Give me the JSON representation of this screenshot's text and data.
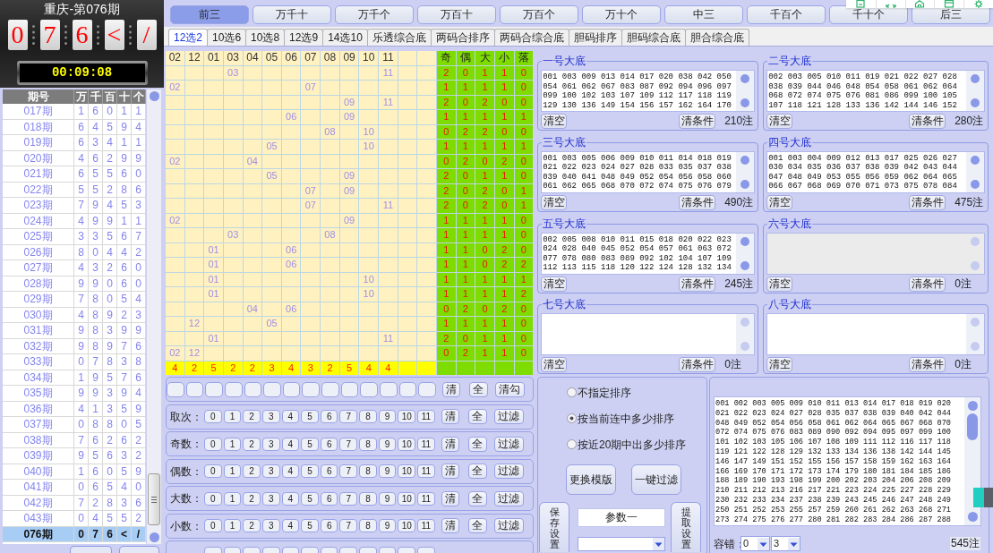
{
  "draw": {
    "title": "重庆-第076期",
    "digits": [
      "0",
      "7",
      "6",
      "<",
      "/"
    ],
    "timer": "00:09:08"
  },
  "history": {
    "columns": [
      "期号",
      "万",
      "千",
      "百",
      "十",
      "个"
    ],
    "rows": [
      {
        "period": "017期",
        "digits": [
          "1",
          "6",
          "0",
          "1",
          "1"
        ],
        "selected": false
      },
      {
        "period": "018期",
        "digits": [
          "6",
          "4",
          "5",
          "9",
          "4"
        ],
        "selected": false
      },
      {
        "period": "019期",
        "digits": [
          "6",
          "3",
          "4",
          "1",
          "1"
        ],
        "selected": false
      },
      {
        "period": "020期",
        "digits": [
          "4",
          "6",
          "2",
          "9",
          "9"
        ],
        "selected": false
      },
      {
        "period": "021期",
        "digits": [
          "6",
          "5",
          "5",
          "6",
          "0"
        ],
        "selected": false
      },
      {
        "period": "022期",
        "digits": [
          "5",
          "5",
          "2",
          "8",
          "6"
        ],
        "selected": false
      },
      {
        "period": "023期",
        "digits": [
          "7",
          "9",
          "4",
          "5",
          "3"
        ],
        "selected": false
      },
      {
        "period": "024期",
        "digits": [
          "4",
          "9",
          "9",
          "1",
          "1"
        ],
        "selected": false
      },
      {
        "period": "025期",
        "digits": [
          "3",
          "3",
          "5",
          "6",
          "7"
        ],
        "selected": false
      },
      {
        "period": "026期",
        "digits": [
          "8",
          "0",
          "4",
          "4",
          "2"
        ],
        "selected": false
      },
      {
        "period": "027期",
        "digits": [
          "4",
          "3",
          "2",
          "6",
          "0"
        ],
        "selected": false
      },
      {
        "period": "028期",
        "digits": [
          "9",
          "9",
          "0",
          "6",
          "0"
        ],
        "selected": false
      },
      {
        "period": "029期",
        "digits": [
          "7",
          "8",
          "0",
          "5",
          "4"
        ],
        "selected": false
      },
      {
        "period": "030期",
        "digits": [
          "4",
          "8",
          "9",
          "2",
          "3"
        ],
        "selected": false
      },
      {
        "period": "031期",
        "digits": [
          "9",
          "8",
          "3",
          "9",
          "9"
        ],
        "selected": false
      },
      {
        "period": "032期",
        "digits": [
          "9",
          "8",
          "9",
          "7",
          "6"
        ],
        "selected": false
      },
      {
        "period": "033期",
        "digits": [
          "0",
          "7",
          "8",
          "3",
          "8"
        ],
        "selected": false
      },
      {
        "period": "034期",
        "digits": [
          "1",
          "9",
          "5",
          "7",
          "6"
        ],
        "selected": false
      },
      {
        "period": "035期",
        "digits": [
          "9",
          "9",
          "3",
          "9",
          "4"
        ],
        "selected": false
      },
      {
        "period": "036期",
        "digits": [
          "4",
          "1",
          "3",
          "5",
          "9"
        ],
        "selected": false
      },
      {
        "period": "037期",
        "digits": [
          "0",
          "8",
          "8",
          "0",
          "5"
        ],
        "selected": false
      },
      {
        "period": "038期",
        "digits": [
          "7",
          "6",
          "2",
          "6",
          "2"
        ],
        "selected": false
      },
      {
        "period": "039期",
        "digits": [
          "9",
          "5",
          "6",
          "3",
          "2"
        ],
        "selected": false
      },
      {
        "period": "040期",
        "digits": [
          "1",
          "6",
          "0",
          "5",
          "9"
        ],
        "selected": false
      },
      {
        "period": "041期",
        "digits": [
          "0",
          "6",
          "5",
          "4",
          "0"
        ],
        "selected": false
      },
      {
        "period": "042期",
        "digits": [
          "7",
          "2",
          "8",
          "3",
          "6"
        ],
        "selected": false
      },
      {
        "period": "043期",
        "digits": [
          "0",
          "4",
          "5",
          "5",
          "2"
        ],
        "selected": false
      },
      {
        "period": "076期",
        "digits": [
          "0",
          "7",
          "6",
          "<",
          "/"
        ],
        "selected": true
      }
    ]
  },
  "position_tabs": [
    {
      "label": "前三",
      "selected": true
    },
    {
      "label": "万千十",
      "selected": false
    },
    {
      "label": "万千个",
      "selected": false
    },
    {
      "label": "万百十",
      "selected": false
    },
    {
      "label": "万百个",
      "selected": false
    },
    {
      "label": "万十个",
      "selected": false
    },
    {
      "label": "中三",
      "selected": false
    },
    {
      "label": "千百个",
      "selected": false
    },
    {
      "label": "千十个",
      "selected": false
    },
    {
      "label": "后三",
      "selected": false
    }
  ],
  "mode_tabs": [
    {
      "label": "12选2",
      "selected": true
    },
    {
      "label": "10选6",
      "selected": false
    },
    {
      "label": "10选8",
      "selected": false
    },
    {
      "label": "12选9",
      "selected": false
    },
    {
      "label": "14选10",
      "selected": false
    },
    {
      "label": "乐透综合底",
      "selected": false
    },
    {
      "label": "两码合排序",
      "selected": false
    },
    {
      "label": "两码合综合底",
      "selected": false
    },
    {
      "label": "胆码排序",
      "selected": false
    },
    {
      "label": "胆码综合底",
      "selected": false
    },
    {
      "label": "胆合综合底",
      "selected": false
    }
  ],
  "grid": {
    "header": [
      "02",
      "12",
      "01",
      "03",
      "04",
      "05",
      "06",
      "07",
      "08",
      "09",
      "10",
      "11"
    ],
    "stat_header": [
      "奇",
      "偶",
      "大",
      "小",
      "落"
    ],
    "rows": [
      {
        "cells": [
          {},
          {},
          {},
          {
            "value": "03"
          },
          {},
          {},
          {},
          {},
          {},
          {},
          {},
          {
            "value": "11"
          },
          {},
          {}
        ],
        "stats": [
          "2",
          "0",
          "1",
          "1",
          "0"
        ]
      },
      {
        "cells": [
          {
            "value": "02"
          },
          {},
          {},
          {},
          {},
          {},
          {},
          {
            "value": "07"
          },
          {},
          {},
          {},
          {},
          {},
          {}
        ],
        "stats": [
          "1",
          "1",
          "1",
          "1",
          "0"
        ]
      },
      {
        "cells": [
          {},
          {},
          {},
          {},
          {},
          {},
          {},
          {},
          {},
          {
            "value": "09"
          },
          {},
          {
            "value": "11"
          },
          {},
          {}
        ],
        "stats": [
          "2",
          "0",
          "2",
          "0",
          "0"
        ]
      },
      {
        "cells": [
          {},
          {},
          {},
          {},
          {},
          {},
          {
            "value": "06"
          },
          {},
          {},
          {
            "value": "09"
          },
          {},
          {},
          {},
          {}
        ],
        "stats": [
          "1",
          "1",
          "1",
          "1",
          "1"
        ]
      },
      {
        "cells": [
          {},
          {},
          {},
          {},
          {},
          {},
          {},
          {},
          {
            "value": "08"
          },
          {},
          {
            "value": "10"
          },
          {},
          {},
          {}
        ],
        "stats": [
          "0",
          "2",
          "2",
          "0",
          "0"
        ]
      },
      {
        "cells": [
          {},
          {},
          {},
          {},
          {},
          {
            "value": "05"
          },
          {},
          {},
          {},
          {},
          {
            "value": "10"
          },
          {},
          {},
          {}
        ],
        "stats": [
          "1",
          "1",
          "1",
          "1",
          "1"
        ]
      },
      {
        "cells": [
          {
            "value": "02"
          },
          {},
          {},
          {},
          {
            "value": "04"
          },
          {},
          {},
          {},
          {},
          {},
          {},
          {},
          {},
          {}
        ],
        "stats": [
          "0",
          "2",
          "0",
          "2",
          "0"
        ]
      },
      {
        "cells": [
          {},
          {},
          {},
          {},
          {},
          {
            "value": "05"
          },
          {},
          {},
          {},
          {
            "value": "09"
          },
          {},
          {},
          {},
          {}
        ],
        "stats": [
          "2",
          "0",
          "1",
          "1",
          "0"
        ]
      },
      {
        "cells": [
          {},
          {},
          {},
          {},
          {},
          {},
          {},
          {
            "value": "07"
          },
          {},
          {
            "value": "09"
          },
          {},
          {},
          {},
          {}
        ],
        "stats": [
          "2",
          "0",
          "2",
          "0",
          "1"
        ]
      },
      {
        "cells": [
          {},
          {},
          {},
          {},
          {},
          {},
          {},
          {
            "value": "07"
          },
          {},
          {},
          {},
          {
            "value": "11"
          },
          {},
          {}
        ],
        "stats": [
          "2",
          "0",
          "2",
          "0",
          "1"
        ]
      },
      {
        "cells": [
          {
            "value": "02"
          },
          {},
          {},
          {},
          {},
          {},
          {},
          {},
          {},
          {
            "value": "09"
          },
          {},
          {},
          {},
          {}
        ],
        "stats": [
          "1",
          "1",
          "1",
          "1",
          "0"
        ]
      },
      {
        "cells": [
          {},
          {},
          {},
          {
            "value": "03"
          },
          {},
          {},
          {},
          {},
          {
            "value": "08"
          },
          {},
          {},
          {},
          {},
          {}
        ],
        "stats": [
          "1",
          "1",
          "1",
          "1",
          "0"
        ]
      },
      {
        "cells": [
          {},
          {},
          {
            "value": "01"
          },
          {},
          {},
          {},
          {
            "value": "06"
          },
          {},
          {},
          {},
          {},
          {},
          {},
          {}
        ],
        "stats": [
          "1",
          "1",
          "0",
          "2",
          "0"
        ]
      },
      {
        "cells": [
          {},
          {},
          {
            "value": "01"
          },
          {},
          {},
          {},
          {
            "value": "06"
          },
          {},
          {},
          {},
          {},
          {},
          {},
          {}
        ],
        "stats": [
          "1",
          "1",
          "0",
          "2",
          "2"
        ]
      },
      {
        "cells": [
          {},
          {},
          {
            "value": "01"
          },
          {},
          {},
          {},
          {},
          {},
          {},
          {},
          {
            "value": "10"
          },
          {},
          {},
          {}
        ],
        "stats": [
          "1",
          "1",
          "1",
          "1",
          "1"
        ]
      },
      {
        "cells": [
          {},
          {},
          {
            "value": "01"
          },
          {},
          {},
          {},
          {},
          {},
          {},
          {},
          {
            "value": "10"
          },
          {},
          {},
          {}
        ],
        "stats": [
          "1",
          "1",
          "1",
          "1",
          "2"
        ]
      },
      {
        "cells": [
          {},
          {},
          {},
          {},
          {
            "value": "04"
          },
          {},
          {
            "value": "06"
          },
          {},
          {},
          {},
          {},
          {},
          {},
          {}
        ],
        "stats": [
          "0",
          "2",
          "0",
          "2",
          "0"
        ]
      },
      {
        "cells": [
          {},
          {
            "value": "12"
          },
          {},
          {},
          {},
          {
            "value": "05"
          },
          {},
          {},
          {},
          {},
          {},
          {},
          {},
          {}
        ],
        "stats": [
          "1",
          "1",
          "1",
          "1",
          "0"
        ]
      },
      {
        "cells": [
          {},
          {},
          {
            "value": "01"
          },
          {},
          {},
          {},
          {},
          {},
          {},
          {},
          {},
          {
            "value": "11"
          },
          {},
          {}
        ],
        "stats": [
          "2",
          "0",
          "1",
          "1",
          "0"
        ]
      },
      {
        "cells": [
          {
            "value": "02"
          },
          {
            "value": "12"
          },
          {},
          {},
          {},
          {},
          {},
          {},
          {},
          {},
          {},
          {},
          {},
          {}
        ],
        "stats": [
          "0",
          "2",
          "1",
          "1",
          "0"
        ]
      }
    ],
    "totals": [
      "4",
      "2",
      "5",
      "2",
      "2",
      "3",
      "4",
      "3",
      "2",
      "5",
      "4",
      "4"
    ]
  },
  "pools": [
    {
      "title": "一号大底",
      "lines": [
        "001 003 009 013 014 017 020 038 042 050",
        "054 061 062 067 083 087 092 094 096 097",
        "099 100 102 103 107 109 112 117 118 119",
        "129 130 136 149 154 156 157 162 164 170"
      ],
      "disabled": false,
      "clear_button": "清空",
      "reset_button": "清条件",
      "count": "210注"
    },
    {
      "title": "二号大底",
      "lines": [
        "002 003 005 010 011 019 021 022 027 028",
        "038 039 044 046 048 054 058 061 062 064",
        "068 072 074 075 076 081 086 099 100 105",
        "107 118 121 128 133 136 142 144 146 152"
      ],
      "disabled": false,
      "clear_button": "清空",
      "reset_button": "清条件",
      "count": "280注"
    },
    {
      "title": "三号大底",
      "lines": [
        "001 003 005 006 009 010 011 014 018 019",
        "021 022 023 024 027 028 033 035 037 038",
        "039 040 041 048 049 052 054 056 058 060",
        "061 062 065 068 070 072 074 075 076 079"
      ],
      "disabled": false,
      "clear_button": "清空",
      "reset_button": "清条件",
      "count": "490注"
    },
    {
      "title": "四号大底",
      "lines": [
        "001 003 004 009 012 013 017 025 026 027",
        "030 034 035 036 037 038 039 042 043 044",
        "047 048 049 053 055 056 059 062 064 065",
        "066 067 068 069 070 071 073 075 078 084"
      ],
      "disabled": false,
      "clear_button": "清空",
      "reset_button": "清条件",
      "count": "475注"
    },
    {
      "title": "五号大底",
      "lines": [
        "002 005 008 010 011 015 018 020 022 023",
        "024 028 040 045 052 054 057 061 063 072",
        "077 078 080 083 089 092 102 104 107 109",
        "112 113 115 118 120 122 124 128 132 134"
      ],
      "disabled": false,
      "clear_button": "清空",
      "reset_button": "清条件",
      "count": "245注"
    },
    {
      "title": "六号大底",
      "disabled": true,
      "clear_button": "清空",
      "reset_button": "清条件",
      "count": "0注"
    },
    {
      "title": "七号大底",
      "disabled": false,
      "clear_button": "清空",
      "reset_button": "清条件",
      "count": "0注"
    },
    {
      "title": "八号大底",
      "disabled": false,
      "clear_button": "清空",
      "reset_button": "清条件",
      "count": "0注"
    }
  ],
  "selector_row": {
    "slots": [
      {
        "checked": false
      },
      {
        "checked": false
      },
      {
        "checked": false
      },
      {
        "checked": false
      },
      {
        "checked": false
      },
      {
        "checked": false
      },
      {
        "checked": false
      },
      {
        "checked": false
      },
      {
        "checked": false
      },
      {
        "checked": false
      },
      {
        "checked": false
      },
      {
        "checked": false
      },
      {
        "checked": false
      },
      {
        "checked": false
      }
    ],
    "buttons": [
      "清",
      "全",
      "清勾"
    ]
  },
  "filters": [
    {
      "label": "取次：",
      "options": [
        {
          "label": "0",
          "selected": false
        },
        {
          "label": "1",
          "selected": false
        },
        {
          "label": "2",
          "selected": false
        },
        {
          "label": "3",
          "selected": false
        },
        {
          "label": "4",
          "selected": false
        },
        {
          "label": "5",
          "selected": false
        },
        {
          "label": "6",
          "selected": false
        },
        {
          "label": "7",
          "selected": false
        },
        {
          "label": "8",
          "selected": false
        },
        {
          "label": "9",
          "selected": false
        },
        {
          "label": "10",
          "selected": false
        },
        {
          "label": "11",
          "selected": false
        }
      ],
      "buttons": [
        "清",
        "全",
        "过滤"
      ]
    },
    {
      "label": "奇数：",
      "options": [
        {
          "label": "0",
          "selected": false
        },
        {
          "label": "1",
          "selected": false
        },
        {
          "label": "2",
          "selected": false
        },
        {
          "label": "3",
          "selected": false
        },
        {
          "label": "4",
          "selected": false
        },
        {
          "label": "5",
          "selected": false
        },
        {
          "label": "6",
          "selected": false
        },
        {
          "label": "7",
          "selected": false
        },
        {
          "label": "8",
          "selected": false
        },
        {
          "label": "9",
          "selected": false
        },
        {
          "label": "10",
          "selected": false
        },
        {
          "label": "11",
          "selected": false
        }
      ],
      "buttons": [
        "清",
        "全",
        "过滤"
      ]
    },
    {
      "label": "偶数：",
      "options": [
        {
          "label": "0",
          "selected": false
        },
        {
          "label": "1",
          "selected": false
        },
        {
          "label": "2",
          "selected": false
        },
        {
          "label": "3",
          "selected": false
        },
        {
          "label": "4",
          "selected": false
        },
        {
          "label": "5",
          "selected": false
        },
        {
          "label": "6",
          "selected": false
        },
        {
          "label": "7",
          "selected": false
        },
        {
          "label": "8",
          "selected": false
        },
        {
          "label": "9",
          "selected": false
        },
        {
          "label": "10",
          "selected": false
        },
        {
          "label": "11",
          "selected": false
        }
      ],
      "buttons": [
        "清",
        "全",
        "过滤"
      ]
    },
    {
      "label": "大数：",
      "options": [
        {
          "label": "0",
          "selected": false
        },
        {
          "label": "1",
          "selected": false
        },
        {
          "label": "2",
          "selected": false
        },
        {
          "label": "3",
          "selected": false
        },
        {
          "label": "4",
          "selected": false
        },
        {
          "label": "5",
          "selected": false
        },
        {
          "label": "6",
          "selected": false
        },
        {
          "label": "7",
          "selected": false
        },
        {
          "label": "8",
          "selected": false
        },
        {
          "label": "9",
          "selected": false
        },
        {
          "label": "10",
          "selected": false
        },
        {
          "label": "11",
          "selected": false
        }
      ],
      "buttons": [
        "清",
        "全",
        "过滤"
      ]
    },
    {
      "label": "小数：",
      "options": [
        {
          "label": "0",
          "selected": false
        },
        {
          "label": "1",
          "selected": false
        },
        {
          "label": "2",
          "selected": false
        },
        {
          "label": "3",
          "selected": false
        },
        {
          "label": "4",
          "selected": false
        },
        {
          "label": "5",
          "selected": false
        },
        {
          "label": "6",
          "selected": false
        },
        {
          "label": "7",
          "selected": false
        },
        {
          "label": "8",
          "selected": false
        },
        {
          "label": "9",
          "selected": false
        },
        {
          "label": "10",
          "selected": false
        },
        {
          "label": "11",
          "selected": false
        }
      ],
      "buttons": [
        "清",
        "全",
        "过滤"
      ]
    }
  ],
  "sort": {
    "options": [
      {
        "label": "不指定排序",
        "selected": false
      },
      {
        "label": "按当前连中多少排序",
        "selected": true
      },
      {
        "label": "按近20期中出多少排序",
        "selected": false
      }
    ],
    "buttons": [
      "更换模版",
      "一键过滤"
    ],
    "save_button": "保存设置",
    "parameter_field": {
      "value": "参数一"
    },
    "load_button": "提取设置"
  },
  "result": {
    "lines": [
      "001 002 003 005 009 010 011 013 014 017 018 019 020",
      "021 022 023 024 027 028 035 037 038 039 040 042 044",
      "048 049 052 054 056 058 061 062 064 065 067 068 070",
      "072 074 075 076 083 089 090 092 094 095 097 099 100",
      "101 102 103 105 106 107 108 109 111 112 116 117 118",
      "119 121 122 128 129 132 133 134 136 138 142 144 145",
      "146 147 149 151 152 155 156 157 158 159 162 163 164",
      "166 169 170 171 172 173 174 179 180 181 184 185 186",
      "188 189 190 193 198 199 200 202 203 204 206 208 209",
      "210 211 212 213 216 217 221 223 224 225 227 228 229",
      "230 232 233 234 237 238 239 243 245 246 247 248 249",
      "250 251 252 253 255 257 259 260 261 262 263 268 271",
      "273 274 275 276 277 280 281 282 283 284 286 287 288"
    ],
    "tolerance_label": "容错：",
    "tolerance_min": "0",
    "tolerance_max": "3",
    "count": "545注"
  }
}
